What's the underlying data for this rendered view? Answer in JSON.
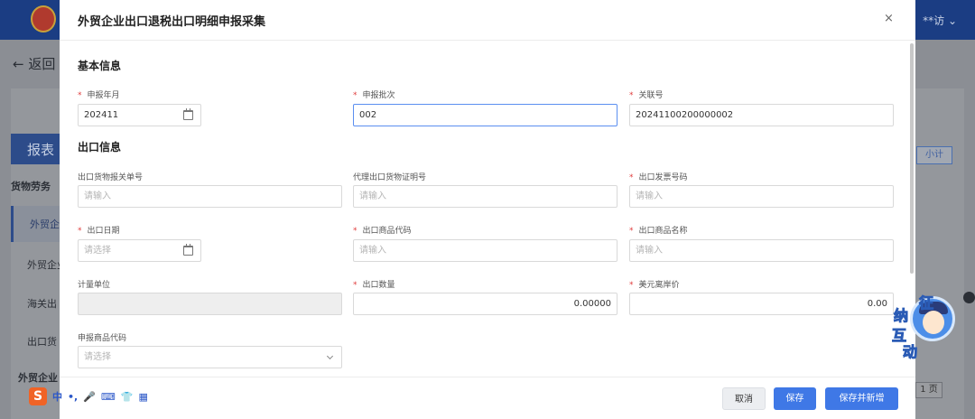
{
  "background": {
    "back_label": "← 返回",
    "user_label": "**访 ⌄",
    "tab_title": "报表",
    "side_items": [
      "货物劳务",
      "外贸企",
      "外贸企业",
      "海关出",
      "出口货",
      "外贸企业"
    ],
    "right_button": "小计",
    "pager": "1 页"
  },
  "modal": {
    "title": "外贸企业出口退税出口明细申报采集",
    "close_label": "×",
    "sections": {
      "basic": "基本信息",
      "export": "出口信息"
    },
    "fields": {
      "declare_month": {
        "label": "申报年月",
        "required": true,
        "value": "202411"
      },
      "declare_batch": {
        "label": "申报批次",
        "required": true,
        "value": "002"
      },
      "link_no": {
        "label": "关联号",
        "required": true,
        "value": "20241100200000002"
      },
      "customs_no": {
        "label": "出口货物报关单号",
        "required": false,
        "placeholder": "请输入"
      },
      "agent_cert_no": {
        "label": "代理出口货物证明号",
        "required": false,
        "placeholder": "请输入"
      },
      "invoice_no": {
        "label": "出口发票号码",
        "required": true,
        "placeholder": "请输入"
      },
      "export_date": {
        "label": "出口日期",
        "required": true,
        "placeholder": "请选择"
      },
      "goods_code": {
        "label": "出口商品代码",
        "required": true,
        "placeholder": "请输入"
      },
      "goods_name": {
        "label": "出口商品名称",
        "required": true,
        "placeholder": "请输入"
      },
      "unit": {
        "label": "计量单位",
        "required": false,
        "value": ""
      },
      "quantity": {
        "label": "出口数量",
        "required": true,
        "value": "0.00000"
      },
      "usd_fob": {
        "label": "美元离岸价",
        "required": true,
        "value": "0.00"
      },
      "declared_code": {
        "label": "申报商品代码",
        "required": false,
        "placeholder": "请选择"
      }
    },
    "buttons": {
      "cancel": "取消",
      "save": "保存",
      "save_new": "保存并新增"
    }
  },
  "ime_toolbar": {
    "logo": "S",
    "items": [
      "中",
      "•,",
      "🎤",
      "⌨",
      "👕",
      "▦"
    ]
  },
  "assistant": {
    "chars": [
      "征",
      "纳",
      "互",
      "动"
    ]
  },
  "colors": {
    "primary": "#3f78e6",
    "required": "#e03c3c",
    "header": "#1b3d83"
  }
}
